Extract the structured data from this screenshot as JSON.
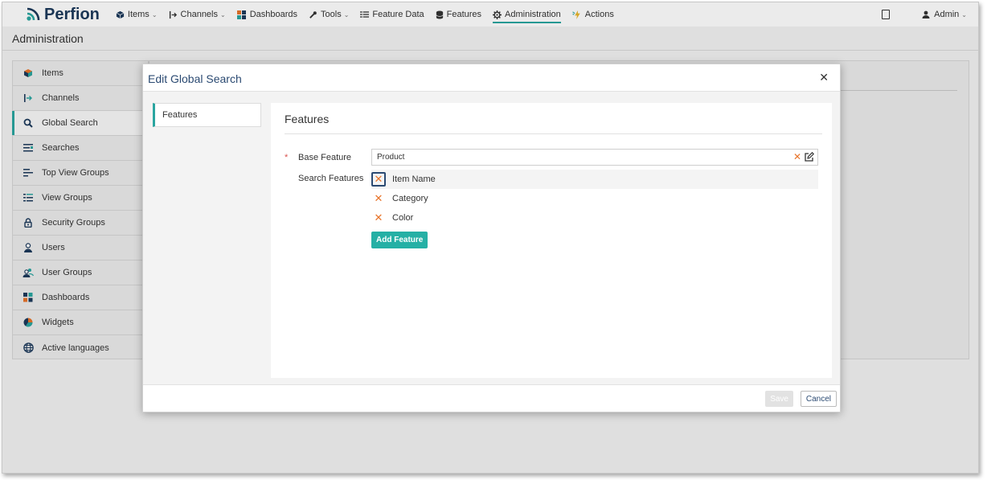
{
  "app": {
    "name": "Perfion"
  },
  "nav": {
    "items": [
      {
        "label": "Items",
        "icon": "cube-icon",
        "dropdown": true
      },
      {
        "label": "Channels",
        "icon": "channel-arrow-icon",
        "dropdown": true
      },
      {
        "label": "Dashboards",
        "icon": "dashboard-grid-icon",
        "dropdown": false
      },
      {
        "label": "Tools",
        "icon": "wrench-icon",
        "dropdown": true
      },
      {
        "label": "Feature Data",
        "icon": "list-icon",
        "dropdown": false
      },
      {
        "label": "Features",
        "icon": "database-icon",
        "dropdown": false
      },
      {
        "label": "Administration",
        "icon": "gear-icon",
        "dropdown": false,
        "active": true
      },
      {
        "label": "Actions",
        "icon": "actions-icon",
        "dropdown": false
      }
    ],
    "user": "Admin"
  },
  "page": {
    "title": "Administration"
  },
  "sidebar": {
    "items": [
      {
        "label": "Items",
        "icon": "cube-icon"
      },
      {
        "label": "Channels",
        "icon": "channel-arrow-icon"
      },
      {
        "label": "Global Search",
        "icon": "search-icon",
        "active": true
      },
      {
        "label": "Searches",
        "icon": "searches-icon"
      },
      {
        "label": "Top View Groups",
        "icon": "top-view-groups-icon"
      },
      {
        "label": "View Groups",
        "icon": "view-groups-icon"
      },
      {
        "label": "Security Groups",
        "icon": "lock-icon"
      },
      {
        "label": "Users",
        "icon": "user-icon"
      },
      {
        "label": "User Groups",
        "icon": "user-groups-icon"
      },
      {
        "label": "Dashboards",
        "icon": "dashboard-grid-icon"
      },
      {
        "label": "Widgets",
        "icon": "pie-icon"
      },
      {
        "label": "Active languages",
        "icon": "globe-icon"
      }
    ]
  },
  "modal": {
    "title": "Edit Global Search",
    "tabs": [
      {
        "label": "Features"
      }
    ],
    "section_title": "Features",
    "base_feature": {
      "label": "Base Feature",
      "value": "Product",
      "required_mark": "*"
    },
    "search_features": {
      "label": "Search Features",
      "items": [
        {
          "name": "Item Name",
          "focused": true
        },
        {
          "name": "Category",
          "focused": false
        },
        {
          "name": "Color",
          "focused": false
        }
      ]
    },
    "add_feature_label": "Add Feature",
    "save_label": "Save",
    "cancel_label": "Cancel",
    "close_glyph": "✕",
    "remove_glyph": "✕"
  },
  "colors": {
    "accent": "#2aa5a0",
    "brand": "#1d3a5c",
    "remove": "#e8742a",
    "button": "#25b0a5"
  }
}
